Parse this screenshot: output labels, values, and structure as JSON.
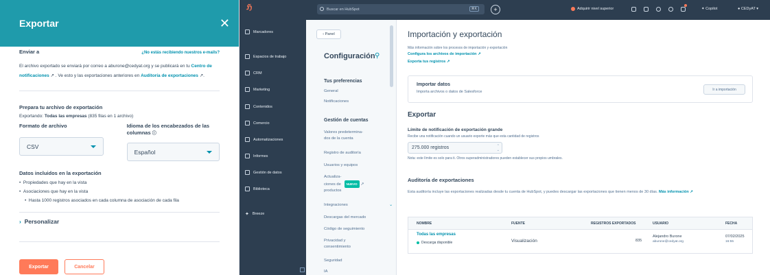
{
  "export_dialog": {
    "title": "Exportar",
    "close_label": "✕",
    "send_to_label": "Enviar a",
    "not_receiving_link": "¿No estás recibiendo nuestros e-mails?",
    "info_text_1": "El archivo exportado se enviará por correo a aburone@cedyat.org y se publicará en tu",
    "info_link_1": "Centro de notificaciones",
    "info_text_2": ". Ve esto y las exportaciones anteriores en",
    "info_link_2": "Auditoría de exportaciones",
    "info_text_3": ".",
    "prepare_heading": "Prepara tu archivo de exportación",
    "exporting_prefix": "Exportando:",
    "exporting_object": "Todas las empresas",
    "exporting_suffix": "(835 filas en 1 archivo)",
    "format_label": "Formato de archivo",
    "format_value": "CSV",
    "language_label": "Idioma de los encabezados de las columnas",
    "language_value": "Español",
    "data_included_label": "Datos incluidos en la exportación",
    "bullets": [
      "Propiedades que hay en la vista",
      "Asociaciones que hay en la vista"
    ],
    "sub_bullet": "Hasta 1000 registros asociados en cada columna de asociación de cada fila",
    "customize_label": "Personalizar",
    "export_button": "Exportar",
    "cancel_button": "Cancelar"
  },
  "nav": {
    "logo": "ℌ",
    "items": [
      {
        "label": "Marcadores",
        "icon": "bookmark-icon"
      },
      {
        "label": "Espacios de trabajo",
        "icon": "grid-icon"
      },
      {
        "label": "CRM",
        "icon": "crm-icon"
      },
      {
        "label": "Marketing",
        "icon": "megaphone-icon"
      },
      {
        "label": "Contenidos",
        "icon": "content-icon"
      },
      {
        "label": "Comercio",
        "icon": "commerce-icon"
      },
      {
        "label": "Automatizaciones",
        "icon": "automation-icon"
      },
      {
        "label": "Informes",
        "icon": "reports-icon"
      },
      {
        "label": "Gestión de datos",
        "icon": "database-icon"
      },
      {
        "label": "Biblioteca",
        "icon": "library-icon"
      },
      {
        "label": "Breeze",
        "icon": "breeze-icon"
      }
    ]
  },
  "topbar": {
    "search_placeholder": "Buscar en HubSpot",
    "search_shortcut": "⌘K",
    "upgrade": "Adquirir nivel superior",
    "copilot": "Copilot",
    "account": "CEDyAT"
  },
  "settings": {
    "panel_button": "‹ Panel",
    "title": "Configuración",
    "section_1": "Tus preferencias",
    "general": "General",
    "notifications": "Notificaciones",
    "section_2": "Gestión de cuentas",
    "item_defaults_1": "Valores predetermina-",
    "item_defaults_2": "dos de la cuenta",
    "item_audit": "Registro de auditoría",
    "item_users": "Usuarios y equipos",
    "item_updates_1": "Actualiza-",
    "item_updates_2": "ciones de",
    "item_updates_3": "productos",
    "badge_new": "NUEVO",
    "item_integrations": "Integraciones",
    "item_marketplace": "Descargas del mercado",
    "item_tracking": "Código de seguimiento",
    "item_privacy_1": "Privacidad y",
    "item_privacy_2": "consentimiento",
    "item_security": "Seguridad",
    "item_ai": "IA"
  },
  "main": {
    "title": "Importación y exportación",
    "more_info": "Más información sobre los procesos de importación y exportación",
    "configure_link": "Configura los archivos de importación ↗",
    "export_records_link": "Exporta tus registros ↗",
    "import_card_title": "Importar datos",
    "import_card_desc": "Importa archivos o datos de Salesforce",
    "import_button": "Ir a importación",
    "export_heading": "Exportar",
    "limit_heading": "Límite de notificación de exportación grande",
    "limit_desc": "Recibe una notificación cuando un usuario exporte más que esta cantidad de registros",
    "limit_value": "275.000 registros",
    "limit_note": "Nota: este límite es solo para ti. Otros superadministradores pueden establecer sus propios umbrales.",
    "audit_heading": "Auditoría de exportaciones",
    "audit_desc": "Esta auditoría incluye las exportaciones realizadas desde tu cuenta de HubSpot, y puedes descargar las exportaciones que tienen menos de 30 días.",
    "audit_link": "Más información ↗",
    "table_headers": [
      "NOMBRE",
      "FUENTE",
      "REGISTROS EXPORTADOS",
      "USUARIO",
      "FECHA"
    ],
    "row": {
      "name": "Todas las empresas",
      "status": "Descarga disponible",
      "source": "Visualización",
      "count": "835",
      "user_name": "Alejandro Burone",
      "user_email": "aburone@cedyat.org",
      "date": "07/02/2025",
      "time": "16:55"
    }
  },
  "colors": {
    "teal_header": "#1f9bab",
    "orange": "#ff7a59",
    "nav_dark": "#2d3e50",
    "link": "#0091ae"
  }
}
